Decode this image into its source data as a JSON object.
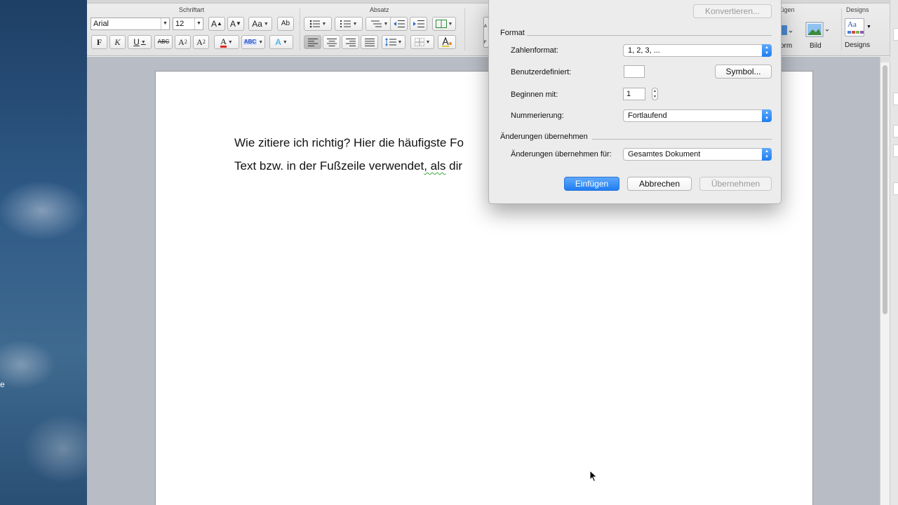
{
  "desktop": {
    "edge_letter": "e"
  },
  "ribbon": {
    "group_schriftart": "Schriftart",
    "group_absatz": "Absatz",
    "group_einfuegen": "fügen",
    "group_designs": "Designs",
    "font_name": "Arial",
    "font_size": "12",
    "bold": "F",
    "italic": "K",
    "underline": "U",
    "strike": "ABC",
    "superscript": "A",
    "subscript": "A",
    "grow": "A",
    "shrink": "A",
    "change_case": "Aa",
    "clear_format": "Ab",
    "form_label": "orm",
    "picture_label": "Bild",
    "designs_label": "Designs",
    "designs_icon_text": "Aa",
    "styles_letter_top": "A",
    "styles_letter_bottom": "F"
  },
  "document": {
    "line1": "Wie zitiere ich richtig? Hier die häufigste Fo",
    "line2_a": "Text bzw. in der Fußzeile verwendet",
    "line2_b": ", als",
    "line2_c": " dir"
  },
  "dialog": {
    "convert_button": "Konvertieren...",
    "section_format": "Format",
    "label_number_format": "Zahlenformat:",
    "value_number_format": "1, 2, 3, ...",
    "label_custom": "Benutzerdefiniert:",
    "symbol_button": "Symbol...",
    "label_start_at": "Beginnen mit:",
    "value_start_at": "1",
    "label_numbering": "Nummerierung:",
    "value_numbering": "Fortlaufend",
    "section_apply": "Änderungen übernehmen",
    "label_apply_to": "Änderungen übernehmen für:",
    "value_apply_to": "Gesamtes Dokument",
    "insert_button": "Einfügen",
    "cancel_button": "Abbrechen",
    "apply_button": "Übernehmen"
  }
}
